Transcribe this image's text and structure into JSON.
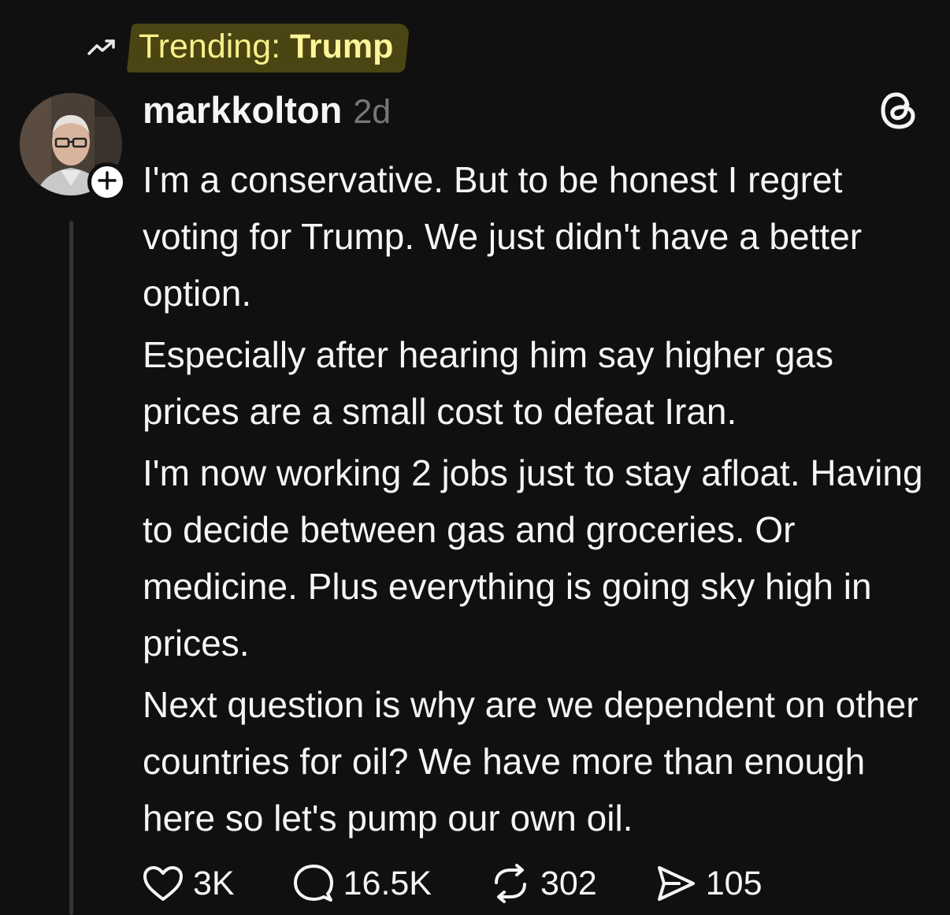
{
  "trending": {
    "icon": "trending-up-icon",
    "prefix": "Trending: ",
    "topic": "Trump",
    "highlight_color": "#4a4512"
  },
  "post": {
    "username": "markkolton",
    "timestamp": "2d",
    "avatar": "avatar",
    "follow_icon": "plus-icon",
    "app_logo": "threads-logo-icon",
    "paragraphs": [
      "I'm a conservative. But to be honest I regret voting for Trump. We just didn't have a better option.",
      "Especially after hearing him say higher gas prices are a small cost to defeat Iran.",
      "I'm now working 2 jobs just to stay afloat. Having to decide between gas and groceries. Or medicine. Plus everything is going sky high in prices.",
      "Next question is why are we dependent on other countries for oil? We have more than enough here so let's pump our own oil."
    ]
  },
  "actions": {
    "likes": {
      "icon": "heart-icon",
      "count": "3K"
    },
    "replies": {
      "icon": "comment-icon",
      "count": "16.5K"
    },
    "reposts": {
      "icon": "repost-icon",
      "count": "302"
    },
    "shares": {
      "icon": "send-icon",
      "count": "105"
    }
  },
  "colors": {
    "background": "#101010",
    "text": "#f3f5f7",
    "muted": "#777777",
    "trending_text": "#fff59a"
  }
}
